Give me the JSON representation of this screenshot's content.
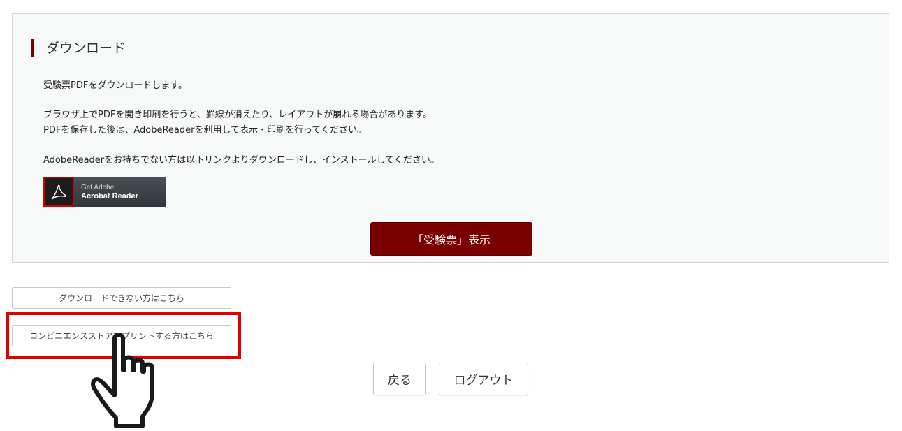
{
  "download_section": {
    "title": "ダウンロード",
    "lines": [
      "受験票PDFをダウンロードします。",
      "ブラウザ上でPDFを開き印刷を行うと、罫線が消えたり、レイアウトが崩れる場合があります。",
      "PDFを保存した後は、AdobeReaderを利用して表示・印刷を行ってください。",
      "AdobeReaderをお持ちでない方は以下リンクよりダウンロードし、インストールしてください。"
    ],
    "adobe_badge": {
      "line1": "Get Adobe",
      "line2": "Acrobat Reader",
      "icon": "acrobat-icon"
    },
    "show_ticket_button": "「受験票」表示"
  },
  "links": {
    "cannot_download": "ダウンロードできない方はこちら",
    "convenience_store_print": "コンビニエンスストアでプリントする方はこちら"
  },
  "nav": {
    "back": "戻る",
    "logout": "ログアウト"
  },
  "annotation": {
    "highlight_color": "#e00000",
    "pointer_icon": "hand-pointer-icon"
  },
  "colors": {
    "accent": "#7a0000",
    "panel_bg": "#f7f8f8"
  }
}
